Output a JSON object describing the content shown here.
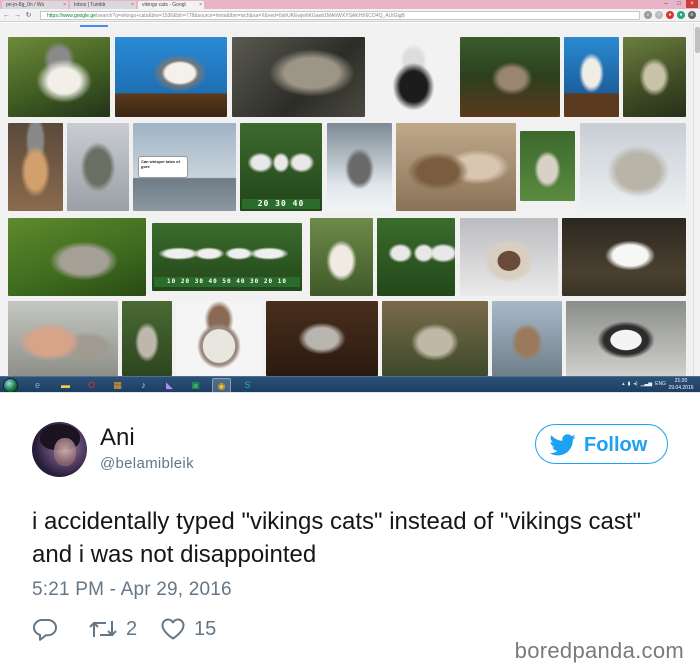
{
  "browser": {
    "tabs": [
      {
        "label": "pn-jn-8g_0n / Wo",
        "active": false
      },
      {
        "label": "Inbox | Tumblr",
        "active": false
      },
      {
        "label": "vikings cats - Googl",
        "active": true
      }
    ],
    "url_host": "https://www.google.ge",
    "url_path": "/search?q=vikings+cats&biw=1536&bih=778&source=lnms&tbm=isch&sa=X&ved=0ahUKEwjwhKGaeb1MAhWXYSAKHX6CO4Q_AUIGigB",
    "image_captions": {
      "cartoon_title": "Can whisper tales of gore",
      "score_a": "20 30 40",
      "score_b": "10 20 30 40 50 40 30 20 10"
    }
  },
  "taskbar": {
    "clock_time": "21:20",
    "clock_date": "29.04.2016",
    "lang": "ENG"
  },
  "tweet": {
    "display_name": "Ani",
    "handle": "@belamibleik",
    "follow_label": "Follow",
    "text": "i accidentally typed \"vikings cats\" instead of \"vikings cast\" and i was not disappointed",
    "timestamp": "5:21 PM - Apr 29, 2016",
    "retweets": "2",
    "likes": "15"
  },
  "watermark": "boredpanda.com",
  "colors": {
    "twitter_blue": "#1da1f2",
    "muted_text": "#657786",
    "primary_text": "#14171a"
  },
  "icons": [
    "reply-icon",
    "retweet-icon",
    "like-icon",
    "twitter-bird-icon",
    "windows-start-icon"
  ]
}
